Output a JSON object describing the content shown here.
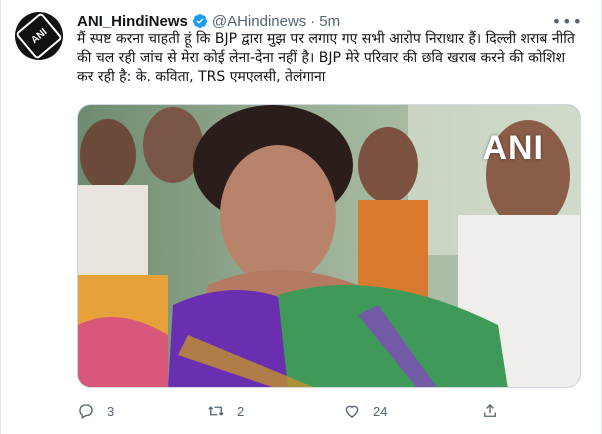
{
  "account": {
    "name": "ANI_HindiNews",
    "handle": "@AHindinews",
    "separator": "·",
    "time": "5m",
    "avatar_text": "ANI"
  },
  "tweet_text": "मैं स्पष्ट करना चाहती हूं कि BJP द्वारा मुझ पर लगाए गए सभी आरोप निराधार हैं। दिल्ली शराब नीति की चल रही जांच से मेरा कोई लेना-देना नहीं है। BJP मेरे परिवार की छवि खराब करने की कोशिश कर रही है: के. कविता, TRS एमएलसी, तेलंगाना",
  "media": {
    "watermark": "ANI"
  },
  "actions": {
    "reply_count": "3",
    "retweet_count": "2",
    "like_count": "24"
  },
  "icons": {
    "verified": "verified-badge-icon",
    "more": "more-icon",
    "reply": "reply-icon",
    "retweet": "retweet-icon",
    "like": "like-icon",
    "share": "share-icon"
  },
  "colors": {
    "verified": "#1d9bf0",
    "muted": "#536471",
    "text": "#0f1419"
  }
}
